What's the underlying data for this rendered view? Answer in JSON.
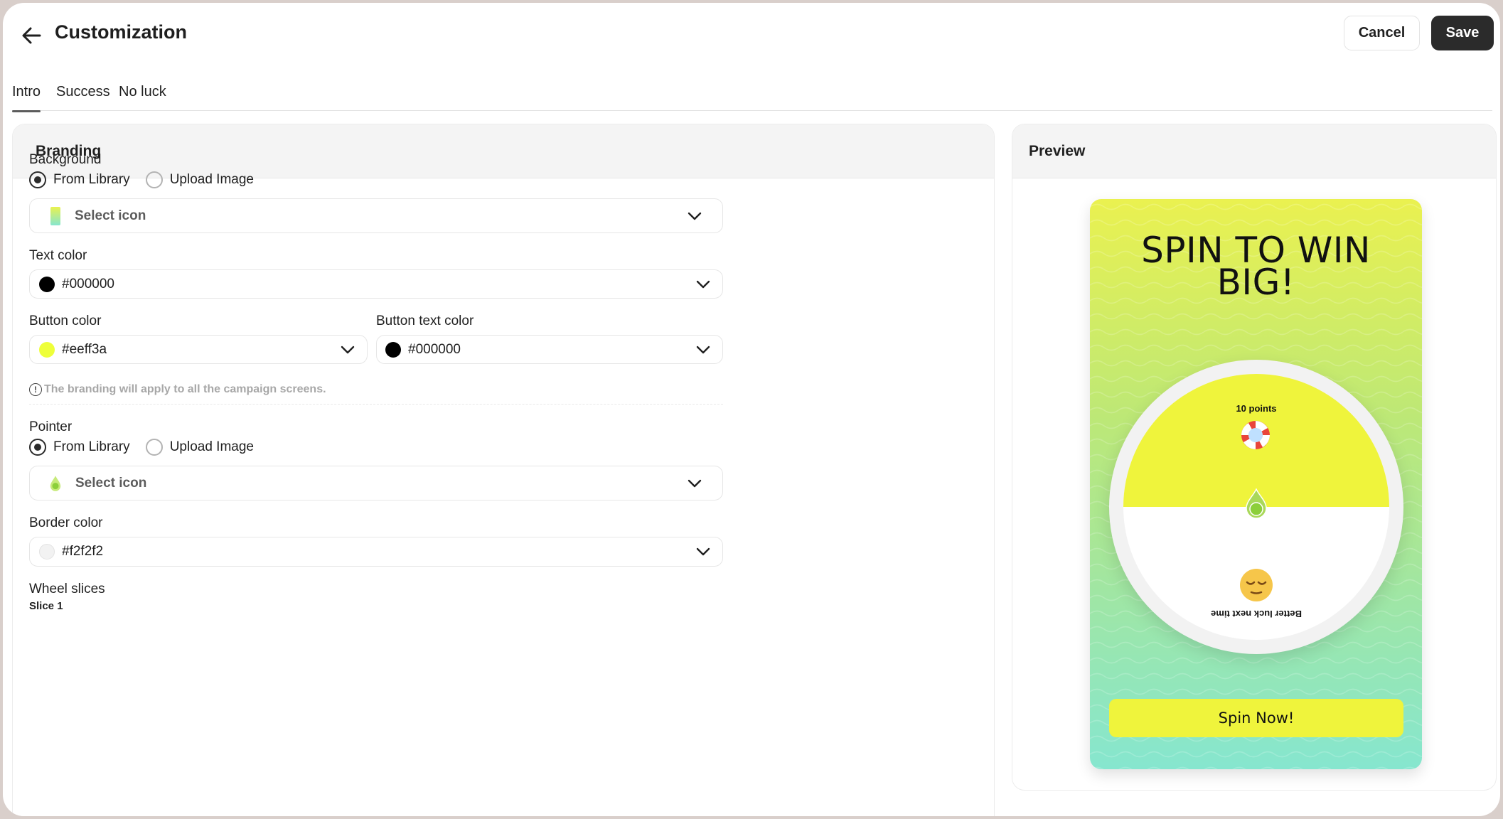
{
  "header": {
    "title": "Customization",
    "cancel_label": "Cancel",
    "save_label": "Save"
  },
  "tabs": [
    {
      "label": "Intro",
      "active": true
    },
    {
      "label": "Success",
      "active": false
    },
    {
      "label": "No luck",
      "active": false
    }
  ],
  "branding": {
    "title": "Branding",
    "background": {
      "label": "Background",
      "options": [
        "From Library",
        "Upload Image"
      ],
      "selected": "From Library",
      "select_placeholder": "Select icon"
    },
    "text_color": {
      "label": "Text color",
      "value": "#000000"
    },
    "button_color": {
      "label": "Button color",
      "value": "#eeff3a"
    },
    "button_text_color": {
      "label": "Button text color",
      "value": "#000000"
    },
    "hint": "The branding will apply to all the campaign screens.",
    "pointer": {
      "label": "Pointer",
      "options": [
        "From Library",
        "Upload Image"
      ],
      "selected": "From Library",
      "select_placeholder": "Select icon"
    },
    "border_color": {
      "label": "Border color",
      "value": "#f2f2f2"
    },
    "wheel_slices": {
      "label": "Wheel slices",
      "first_slice": "Slice 1"
    }
  },
  "preview": {
    "title": "Preview",
    "headline_line1": "SPIN TO WIN",
    "headline_line2": "BIG!",
    "slices": [
      {
        "label": "10 points",
        "icon": "lifebuoy-icon",
        "color": "#eff43c"
      },
      {
        "label": "Better luck next time",
        "icon": "relieved-face-icon",
        "color": "#ffffff"
      }
    ],
    "button_label": "Spin Now!"
  },
  "colors": {
    "accent_dark": "#2b2b2b",
    "button_yellow": "#eeff3a",
    "border_grey": "#f2f2f2"
  }
}
